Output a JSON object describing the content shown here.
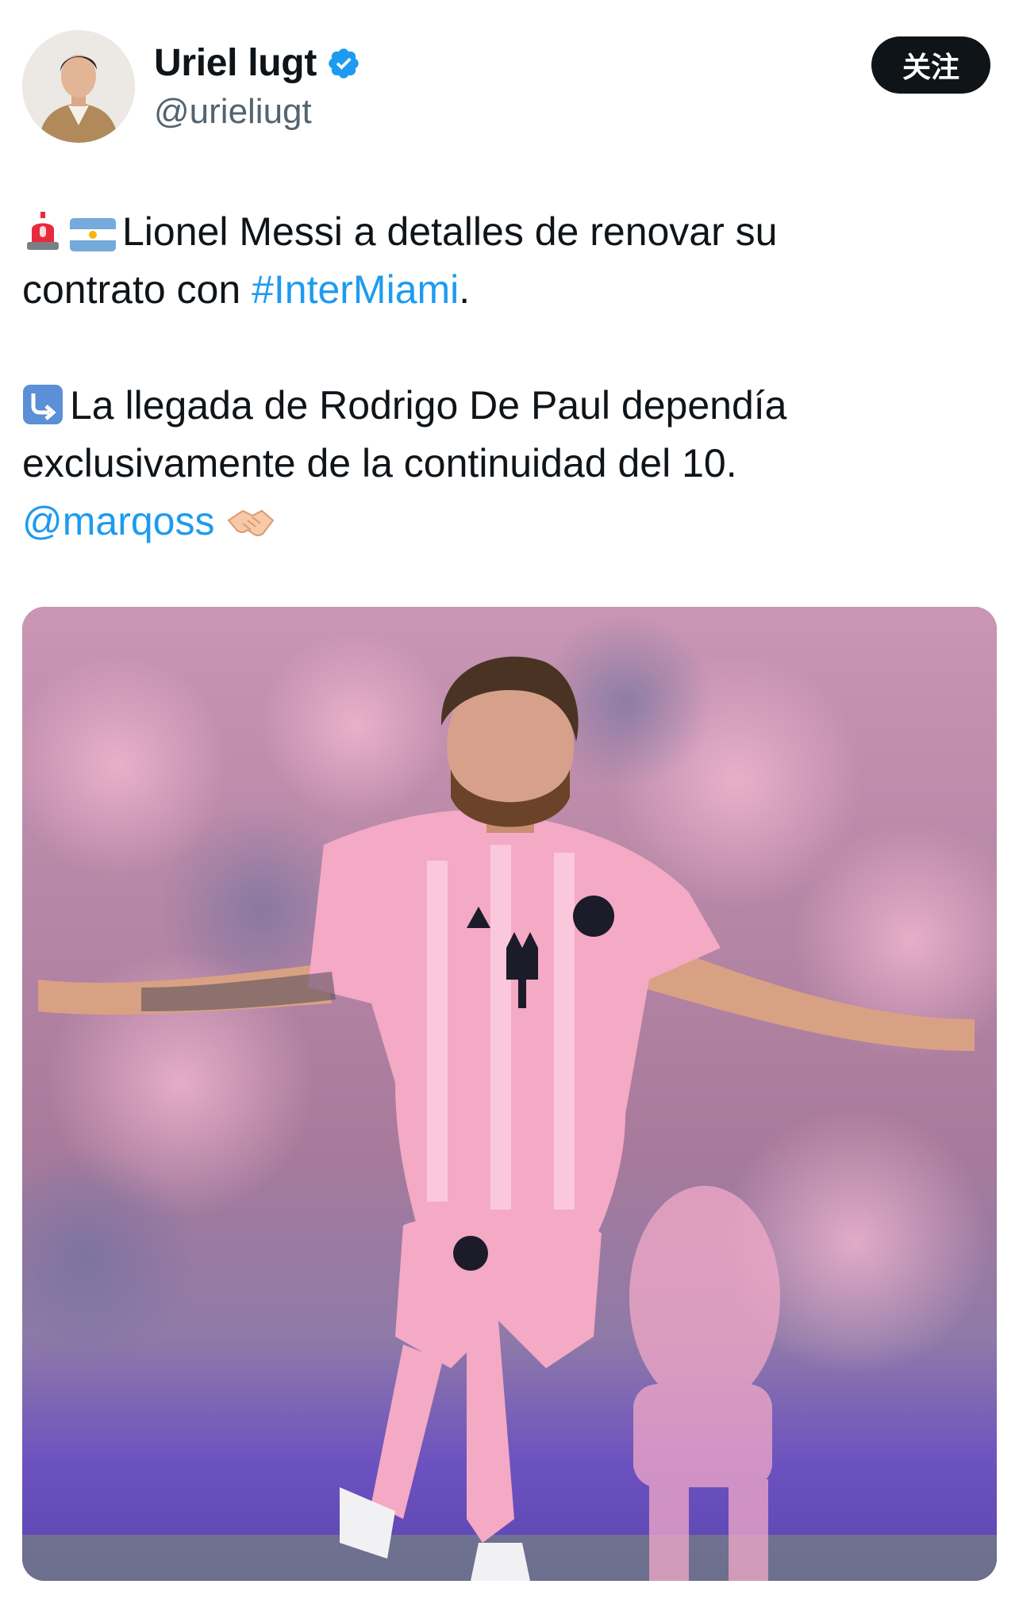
{
  "author": {
    "display_name": "Uriel lugt",
    "handle": "@urieliugt",
    "verified": true
  },
  "follow_button": {
    "label": "关注"
  },
  "tweet": {
    "line1_text": "Lionel Messi a detalles de renovar su",
    "line2_text": "contrato con",
    "hashtag": "#InterMiami",
    "period": ".",
    "para2_line1": "La llegada de Rodrigo De Paul dependía",
    "para2_line2": "exclusivamente de la continuidad del 10.",
    "mention": "@marqoss",
    "emoji_names": [
      "rotating-light-icon",
      "argentina-flag-icon",
      "arrow-curving-right-icon",
      "handshake-icon"
    ]
  },
  "media": {
    "type": "photo",
    "colors": {
      "jersey_pink": "#f4a9c4",
      "crowd": "#b27a98",
      "pitch": "#7a5cc9"
    }
  },
  "colors": {
    "link": "#1d9bf0",
    "text": "#0f1419",
    "secondary": "#536471",
    "verified": "#1d9bf0"
  }
}
